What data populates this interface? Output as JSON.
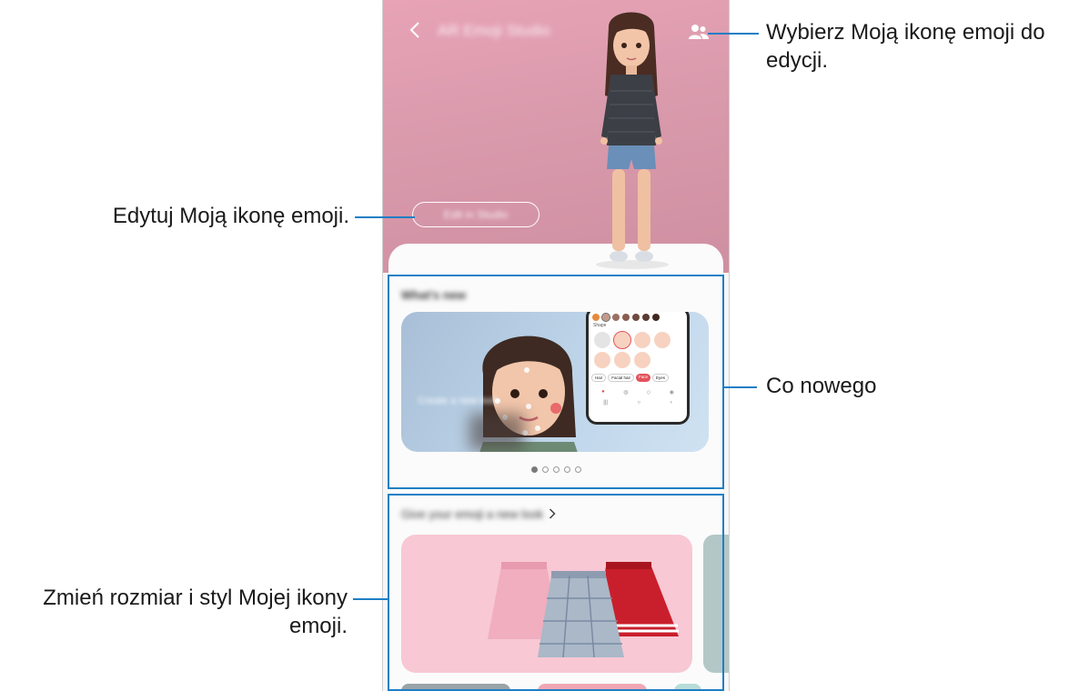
{
  "callouts": {
    "select_avatar": "Wybierz Moją ikonę emoji do edycji.",
    "edit_avatar": "Edytuj Moją ikonę emoji.",
    "whats_new": "Co nowego",
    "resize_style_line1": "Zmień rozmiar i styl Mojej ikony",
    "resize_style_line2": "emoji."
  },
  "phone": {
    "app_title": "AR Emoji Studio",
    "edit_button_label": "Edit in Studio",
    "whats_new_title": "What's new",
    "banner_caption": "Create a new look",
    "carousel_pages": 5,
    "carousel_active_index": 0,
    "outfit_section_title": "Give your emoji a new look",
    "editor_mock": {
      "shape_label": "Shape",
      "chips": [
        "Hair",
        "Facial hair",
        "Face",
        "Eyes"
      ]
    }
  },
  "colors": {
    "callout_line": "#1e7fc5",
    "hero_bg": "#d99aac",
    "outfit_card_bg": "#f8c8d4"
  },
  "icons": [
    "chevron-left-icon",
    "people-icon",
    "chevron-right-icon"
  ]
}
